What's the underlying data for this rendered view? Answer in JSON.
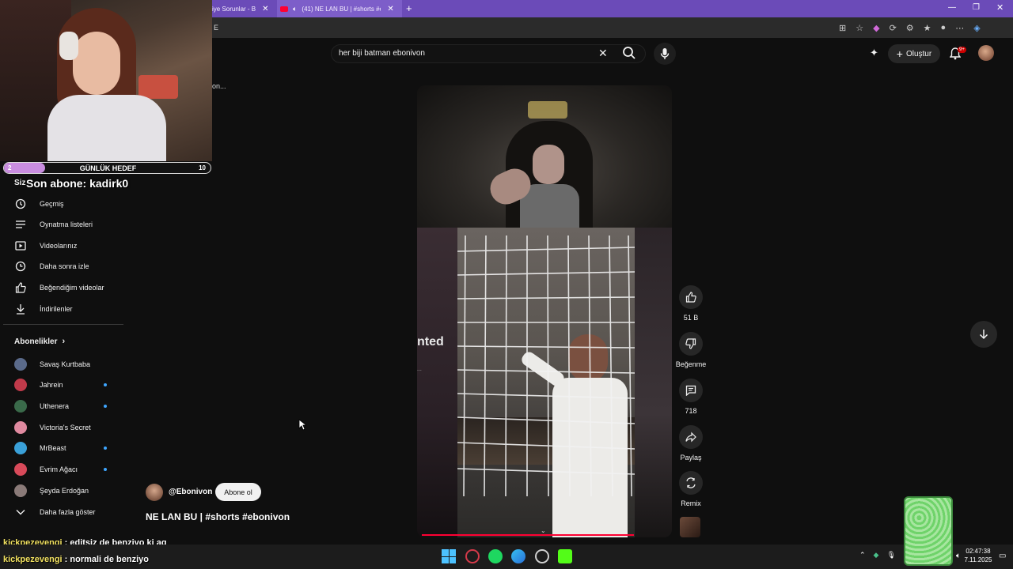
{
  "browser": {
    "tabs": [
      {
        "label": "iye Sorunlar - B"
      },
      {
        "label": "(41) NE LAN BU | #shorts #e"
      }
    ],
    "url_fragment": "E"
  },
  "youtube": {
    "search_value": "her biji batman ebonivon",
    "create_label": "Oluştur",
    "notif_count": "9+"
  },
  "stream_overlay": {
    "goal_left": "2",
    "goal_title": "GÜNLÜK HEDEF",
    "goal_right": "10",
    "goal_progress": 0.2,
    "last_sub": "Son abone: kadirk0"
  },
  "sidebar": {
    "section_label": "Siz",
    "items": [
      {
        "label": "Geçmiş",
        "icon": "history-icon"
      },
      {
        "label": "Oynatma listeleri",
        "icon": "playlist-icon"
      },
      {
        "label": "Videolarınız",
        "icon": "your-videos-icon"
      },
      {
        "label": "Daha sonra izle",
        "icon": "watch-later-icon"
      },
      {
        "label": "Beğendiğim videolar",
        "icon": "liked-icon"
      },
      {
        "label": "İndirilenler",
        "icon": "download-icon"
      }
    ],
    "subs_heading": "Abonelikler",
    "subscriptions": [
      {
        "label": "Savaş Kurtbaba",
        "color": "#5a6a8a",
        "new": false
      },
      {
        "label": "Jahrein",
        "color": "#c03a4a",
        "new": true
      },
      {
        "label": "Uthenera",
        "color": "#3a6a4a",
        "new": true
      },
      {
        "label": "Victoria's Secret",
        "color": "#e08aa0",
        "new": false
      },
      {
        "label": "MrBeast",
        "color": "#3aa0d8",
        "new": true
      },
      {
        "label": "Evrim Ağacı",
        "color": "#d84a5a",
        "new": true
      },
      {
        "label": "Şeyda Erdoğan",
        "color": "#8a7a78",
        "new": false
      }
    ],
    "show_more": "Daha fazla göster",
    "truncated_text": "on..."
  },
  "short": {
    "overlay_text": "nted",
    "overlay_sub": "...",
    "channel": "@Ebonivon",
    "subscribe_label": "Abone ol",
    "title": "NE LAN BU | #shorts #ebonivon",
    "likes": "51 B",
    "dislike_label": "Beğenme",
    "comments": "718",
    "share_label": "Paylaş",
    "remix_label": "Remix"
  },
  "chat": [
    {
      "user": "kickpezevengi",
      "message": ": editsiz de benziyo ki aq"
    },
    {
      "user": "kickpezevengi",
      "message": ": normali de benziyo"
    }
  ],
  "taskbar": {
    "time": "02:47:38",
    "date": "7.11.2025"
  }
}
